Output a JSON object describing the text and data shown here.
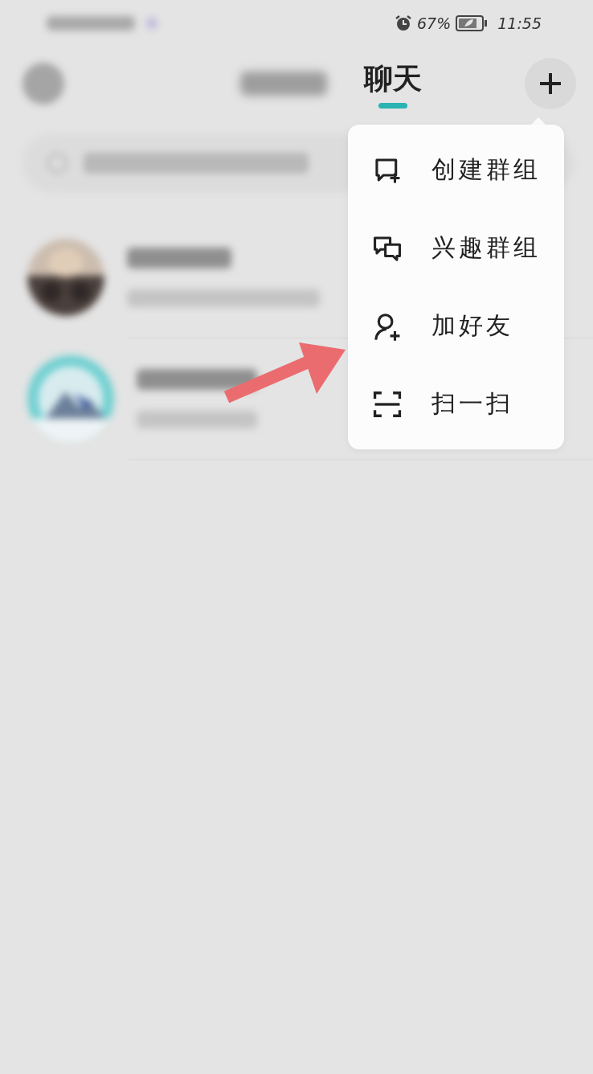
{
  "status_bar": {
    "battery": "67%",
    "time": "11:55"
  },
  "header": {
    "tabs": [
      {
        "label": "聊天",
        "selected": true
      }
    ]
  },
  "menu": {
    "items": [
      {
        "kind": "create-group",
        "label": "创建群组"
      },
      {
        "kind": "interest-group",
        "label": "兴趣群组"
      },
      {
        "kind": "add-friend",
        "label": "加好友"
      },
      {
        "kind": "scan",
        "label": "扫一扫"
      }
    ]
  }
}
